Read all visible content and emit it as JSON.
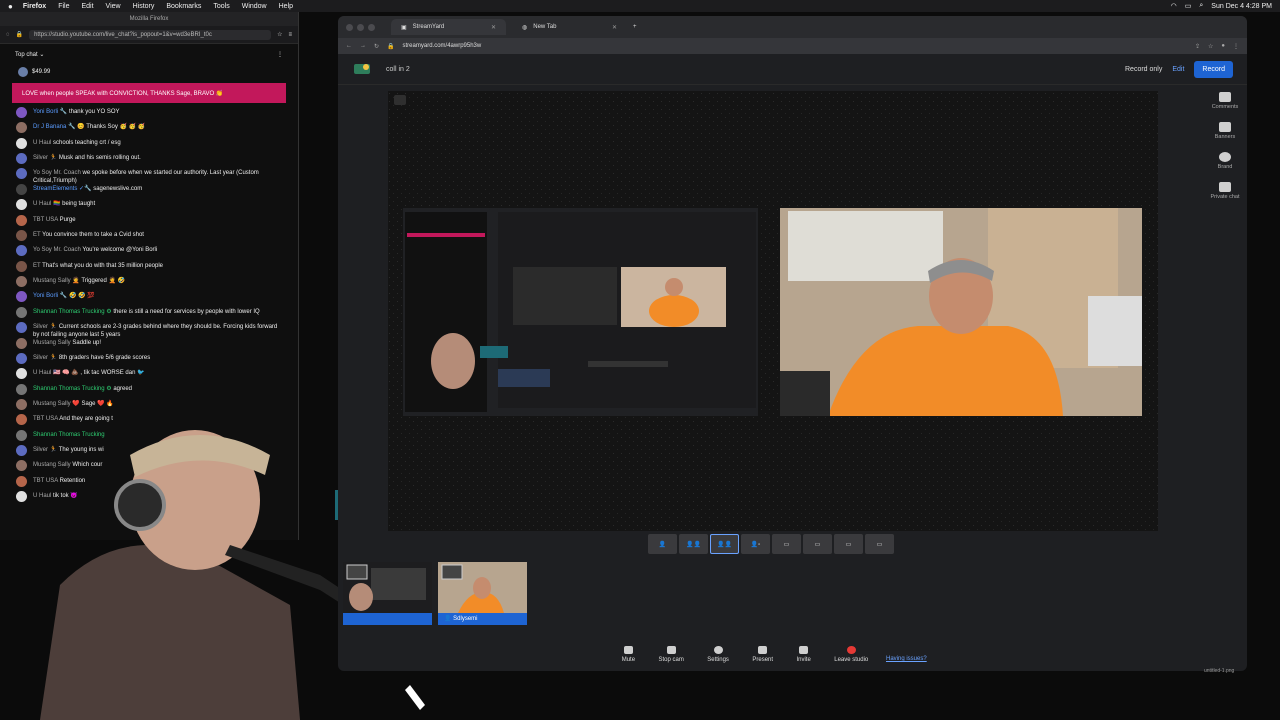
{
  "menubar": {
    "app": "Firefox",
    "items": [
      "File",
      "Edit",
      "View",
      "History",
      "Bookmarks",
      "Tools",
      "Window",
      "Help"
    ],
    "clock": "Sun Dec 4  4:28 PM"
  },
  "chat_window": {
    "window_title": "Mozilla Firefox",
    "url": "https://studio.youtube.com/live_chat?is_popout=1&v=wd3eBRI_t0c",
    "top_chat_label": "Top chat",
    "supers": [
      {
        "amount": "$49.99"
      }
    ],
    "banner_text": "LOVE when people SPEAK with CONVICTION, THANKS Sage, BRAVO 👏",
    "messages": [
      {
        "author": "Yoni Borli 🔧",
        "text": "thank you YO SOY",
        "style": "blue",
        "av": "#7e57c2"
      },
      {
        "author": "Dr J Banana 🔧 😊",
        "text": "Thanks Soy 🥳 🥳 🥳",
        "style": "blue",
        "av": "#8d6e63"
      },
      {
        "author": "U Haul",
        "text": "schools teaching crt / esg",
        "style": "",
        "av": "#e0e0e0"
      },
      {
        "author": "Silver 🏃",
        "text": "Musk and his semis rolling out.",
        "style": "",
        "av": "#5c6bc0"
      },
      {
        "author": "Yo Soy Mr. Coach",
        "text": "we spoke before when we started our authority. Last year (Custom Critical,Triumph)",
        "style": "",
        "av": "#5c6bc0"
      },
      {
        "author": "StreamElements ✓🔧",
        "text": "sagenewslive.com",
        "style": "blue",
        "av": "#444"
      },
      {
        "author": "U Haul",
        "text": "🏳️‍🌈 being taught",
        "style": "",
        "av": "#e0e0e0"
      },
      {
        "author": "TBT USA",
        "text": "Purge",
        "style": "",
        "av": "#b5654a"
      },
      {
        "author": "ET",
        "text": "You convince them to take a Cvid shot",
        "style": "",
        "av": "#795548"
      },
      {
        "author": "Yo Soy Mr. Coach",
        "text": "You're welcome @Yoni Borli",
        "style": "",
        "av": "#5c6bc0"
      },
      {
        "author": "ET",
        "text": "That's what you do with that 35 million people",
        "style": "",
        "av": "#795548"
      },
      {
        "author": "Mustang Sally",
        "text": "🤦 Triggered 🤦 🤣",
        "style": "",
        "av": "#8d6e63"
      },
      {
        "author": "Yoni Borli 🔧",
        "text": "🤣 🤣 💯",
        "style": "blue",
        "av": "#7e57c2"
      },
      {
        "author": "Shannan Thomas Trucking ⚙",
        "text": "there is still a need for services by people with lower IQ",
        "style": "green",
        "av": "#757575"
      },
      {
        "author": "Silver 🏃",
        "text": "Current schools are 2-3 grades behind where they should be. Forcing kids forward by not failing anyone last 5 years",
        "style": "",
        "av": "#5c6bc0"
      },
      {
        "author": "Mustang Sally",
        "text": "Saddle up!",
        "style": "",
        "av": "#8d6e63"
      },
      {
        "author": "Silver 🏃",
        "text": "8th graders have 5/6 grade scores",
        "style": "",
        "av": "#5c6bc0"
      },
      {
        "author": "U Haul",
        "text": "🇺🇸 🧠 💩 , tik tac WORSE dan 🐦",
        "style": "",
        "av": "#e0e0e0"
      },
      {
        "author": "Shannan Thomas Trucking ⚙",
        "text": "agreed",
        "style": "green",
        "av": "#757575"
      },
      {
        "author": "Mustang Sally",
        "text": "❤️ Sage ❤️ 🔥",
        "style": "",
        "av": "#8d6e63"
      },
      {
        "author": "TBT USA",
        "text": "And they are going t",
        "style": "",
        "av": "#b5654a"
      },
      {
        "author": "Shannan Thomas Trucking",
        "text": "",
        "style": "green",
        "av": "#757575"
      },
      {
        "author": "Silver 🏃",
        "text": "The young ins wi",
        "style": "",
        "av": "#5c6bc0"
      },
      {
        "author": "Mustang Sally",
        "text": "Which cour",
        "style": "",
        "av": "#8d6e63"
      },
      {
        "author": "TBT USA",
        "text": "Retention",
        "style": "",
        "av": "#b5654a"
      },
      {
        "author": "U Haul",
        "text": "tik tok 😈",
        "style": "",
        "av": "#e0e0e0"
      }
    ]
  },
  "browser": {
    "tabs": [
      {
        "label": "StreamYard",
        "active": true
      },
      {
        "label": "New Tab",
        "active": false
      }
    ],
    "url": "streamyard.com/4awrp95h3w",
    "header": {
      "broadcast_title": "coll in 2",
      "record_only_label": "Record only",
      "edit_label": "Edit",
      "record_button": "Record"
    },
    "sidebar": [
      {
        "label": "Comments"
      },
      {
        "label": "Banners"
      },
      {
        "label": "Brand"
      },
      {
        "label": "Private chat"
      }
    ],
    "participants": [
      {
        "name": ""
      },
      {
        "name": "Sdlysemi"
      }
    ],
    "controls": [
      {
        "label": "Mute"
      },
      {
        "label": "Stop cam"
      },
      {
        "label": "Settings"
      },
      {
        "label": "Present"
      },
      {
        "label": "Invite"
      },
      {
        "label": "Leave studio"
      }
    ],
    "issues_link": "Having issues?"
  },
  "desktop_label": "untitled-1.png"
}
